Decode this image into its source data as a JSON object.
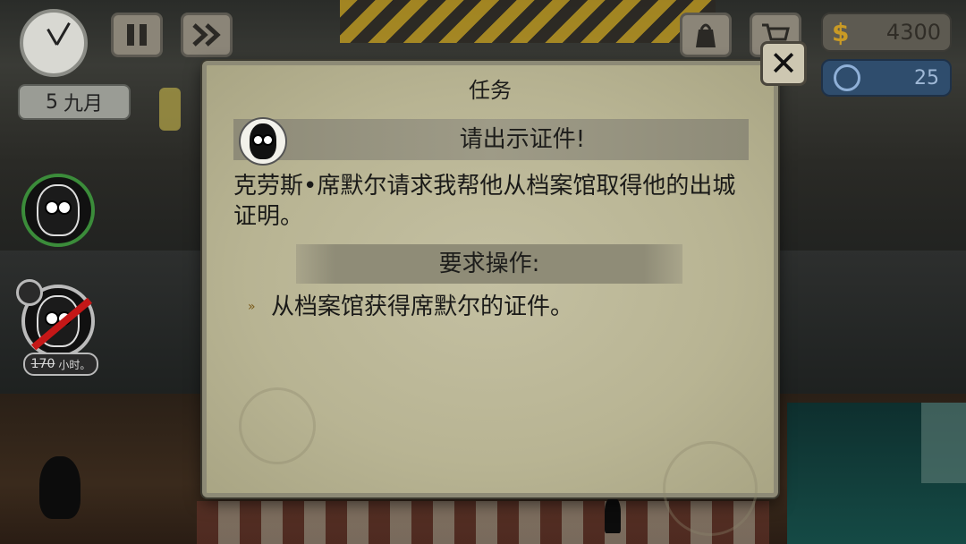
{
  "hud": {
    "date_day": "5",
    "date_month": "九月",
    "money_symbol": "$",
    "money": "4300",
    "tokens": "25",
    "hours_value": "170",
    "hours_unit": "小时。"
  },
  "dialog": {
    "title": "任务",
    "quest_name": "请出示证件!",
    "description": "克劳斯•席默尔请求我帮他从档案馆取得他的出城证明。",
    "requirements_label": "要求操作:",
    "requirement_1": "从档案馆获得席默尔的证件。",
    "close_label": "✕"
  },
  "colors": {
    "panel": "#bcb899",
    "money_icon": "#c99a25",
    "token_panel": "#2f4d6d",
    "active_ring": "#3b8c3a",
    "ban": "#c41717"
  },
  "icons": [
    "clock-icon",
    "pause-icon",
    "fast-forward-icon",
    "bag-icon",
    "cart-icon",
    "dollar-icon",
    "coin-icon",
    "police-badge-icon",
    "close-icon",
    "arrow-right-icon"
  ]
}
